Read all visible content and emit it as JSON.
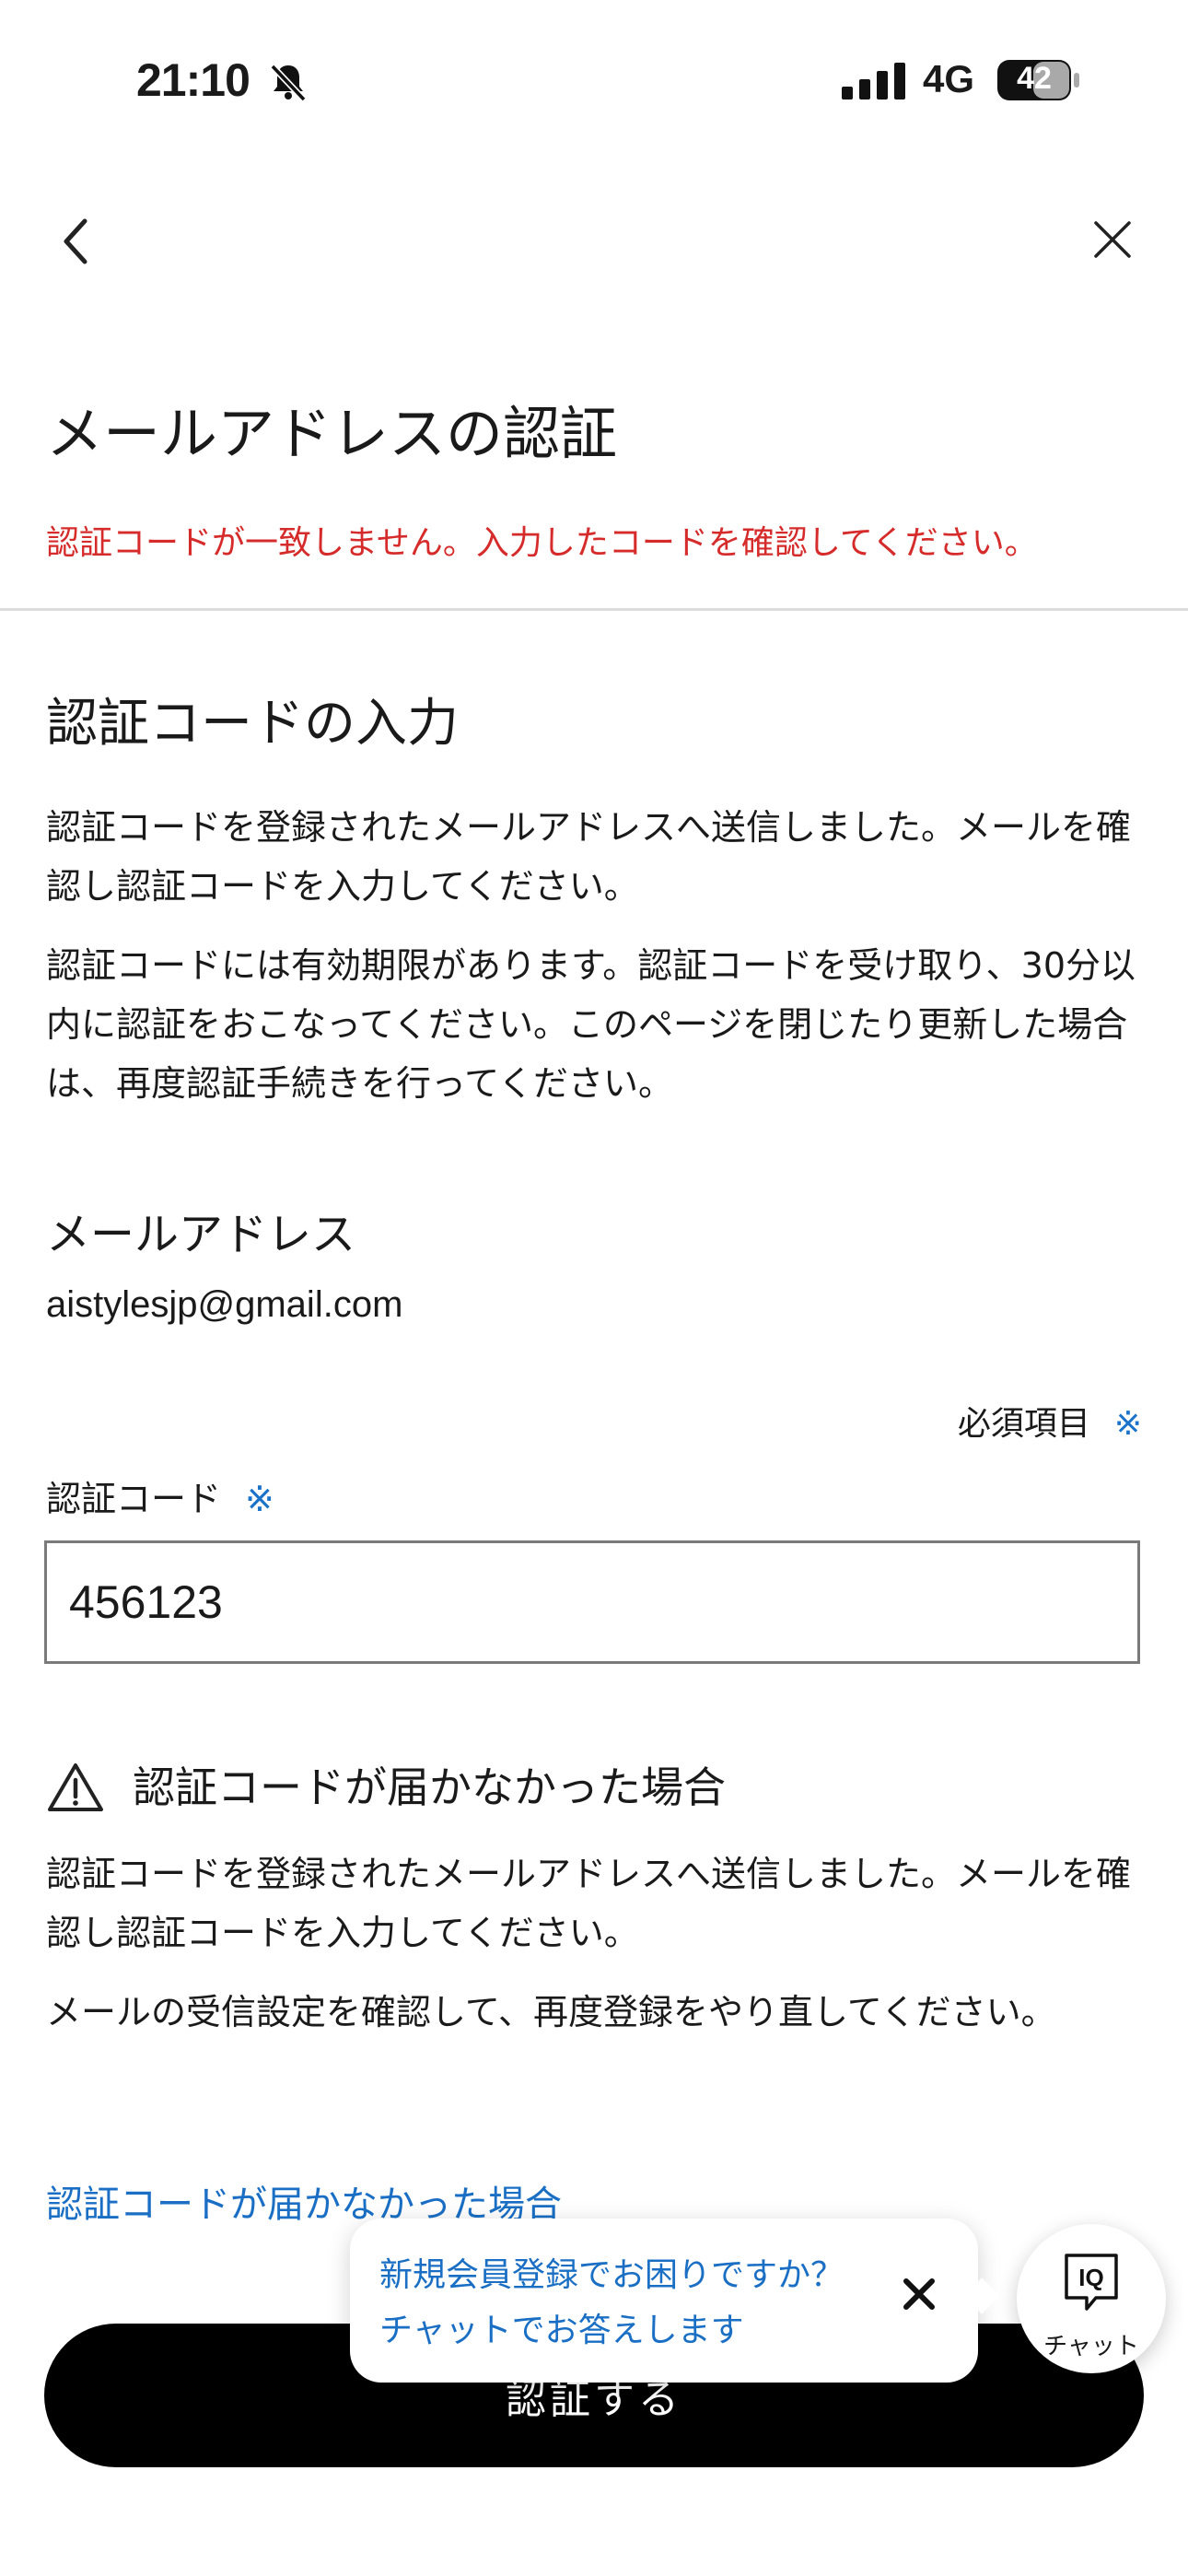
{
  "status_bar": {
    "time": "21:10",
    "network": "4G",
    "battery": "42",
    "icons": [
      "bell-slash-icon",
      "signal-icon",
      "battery-icon"
    ]
  },
  "nav": {
    "icons": [
      "chevron-left-icon",
      "close-icon"
    ]
  },
  "header": {
    "title": "メールアドレスの認証",
    "error": "認証コードが一致しません。入力したコードを確認してください。"
  },
  "main": {
    "section_title": "認証コードの入力",
    "intro_1": "認証コードを登録されたメールアドレスへ送信しました。メールを確認し認証コードを入力してください。",
    "intro_2": "認証コードには有効期限があります。認証コードを受け取り、30分以内に認証をおこなってください。このページを閉じたり更新した場合は、再度認証手続きを行ってください。",
    "email_label": "メールアドレス",
    "email_value": "aistylesjp@gmail.com",
    "required_note": "必須項目",
    "required_mark": "※",
    "code_label": "認証コード",
    "code_value": "456123"
  },
  "help": {
    "title": "認証コードが届かなかった場合",
    "text_1": "認証コードを登録されたメールアドレスへ送信しました。メールを確認し認証コードを入力してください。",
    "text_2": "メールの受信設定を確認して、再度登録をやり直してください。",
    "link": "認証コードが届かなかった場合",
    "icon": "warning-triangle-icon"
  },
  "cta": {
    "label": "認証する"
  },
  "chat": {
    "bubble_line_1": "新規会員登録でお困りですか？",
    "bubble_line_2": "チャットでお答えします",
    "button_label": "チャット",
    "logo_text": "IQ",
    "colors": {
      "accent": "#1a6fc4",
      "error": "#d62b2b",
      "cta_bg": "#000000"
    }
  }
}
